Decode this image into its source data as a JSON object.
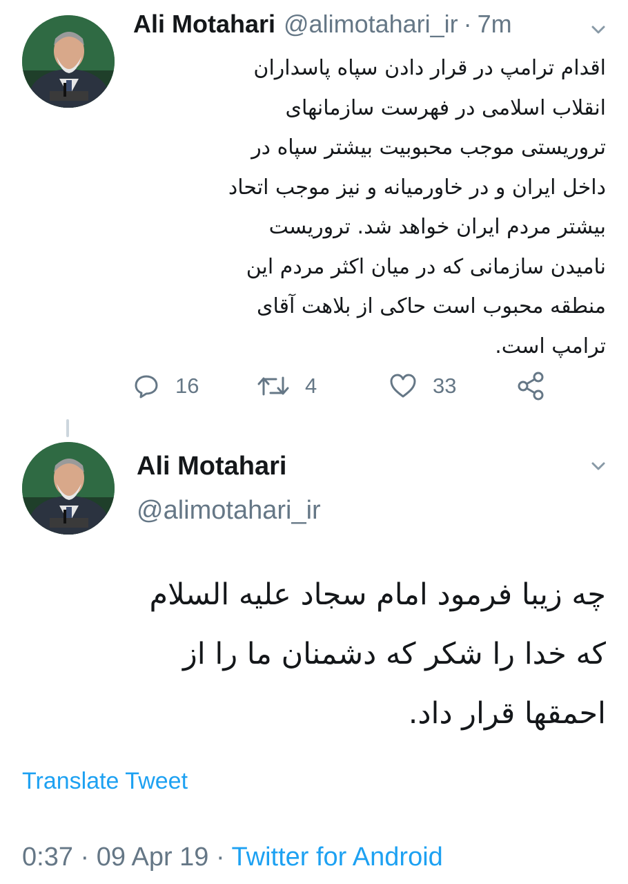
{
  "colors": {
    "text": "#14171a",
    "secondary": "#657786",
    "link": "#1da1f2",
    "thread_line": "#ccd6dd"
  },
  "quoted_tweet": {
    "author_name": "Ali Motahari",
    "author_handle": "@alimotahari_ir",
    "separator": "·",
    "time_ago": "7m",
    "text_lines": [
      "اقدام ترامپ در قرار دادن سپاه پاسداران",
      "انقلاب اسلامی در فهرست سازمانهای",
      "تروریستی موجب محبوبیت بیشتر سپاه در",
      "داخل ایران و در خاورمیانه و نیز موجب اتحاد",
      "بیشتر مردم ایران خواهد شد. تروریست",
      "نامیدن سازمانی که در میان اکثر مردم این",
      "منطقه محبوب است حاکی از بلاهت آقای",
      "ترامپ است."
    ],
    "actions": {
      "reply_icon": "reply-icon",
      "reply_count": "16",
      "retweet_icon": "retweet-icon",
      "retweet_count": "4",
      "like_icon": "heart-icon",
      "like_count": "33",
      "share_icon": "share-icon"
    }
  },
  "main_tweet": {
    "author_name": "Ali Motahari",
    "author_handle": "@alimotahari_ir",
    "text_lines": [
      "چه زیبا فرمود امام سجاد علیه السلام",
      "که خدا را شکر که دشمنان ما را از",
      "احمقها قرار داد."
    ],
    "translate_label": "Translate Tweet",
    "time": "0:37",
    "separator": "·",
    "date": "09 Apr 19",
    "source": "Twitter for Android"
  }
}
